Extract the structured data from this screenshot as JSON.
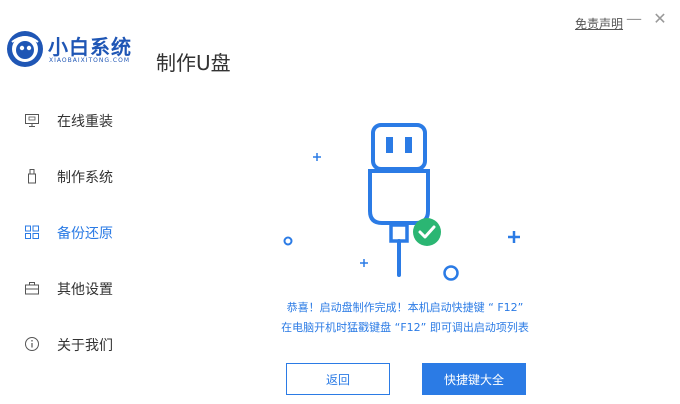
{
  "logo": {
    "title": "小白系统",
    "subtitle": "XIAOBAIXITONG.COM"
  },
  "page_title": "制作U盘",
  "header": {
    "disclaimer": "免责声明",
    "minimize": "—",
    "close": "✕"
  },
  "sidebar": {
    "items": [
      {
        "label": "在线重装",
        "icon": "monitor-icon",
        "active": false
      },
      {
        "label": "制作系统",
        "icon": "usb-drive-icon",
        "active": false
      },
      {
        "label": "备份还原",
        "icon": "grid-icon",
        "active": true
      },
      {
        "label": "其他设置",
        "icon": "briefcase-icon",
        "active": false
      },
      {
        "label": "关于我们",
        "icon": "info-icon",
        "active": false
      }
    ]
  },
  "message": {
    "line1": "恭喜！启动盘制作完成！本机启动快捷键 “ F12”",
    "line2": "在电脑开机时猛戳键盘 “F12” 即可调出启动项列表"
  },
  "buttons": {
    "back": "返回",
    "hotkey": "快捷键大全"
  },
  "colors": {
    "accent": "#2b7be5",
    "brand": "#1f56b5",
    "success": "#2bb673"
  }
}
